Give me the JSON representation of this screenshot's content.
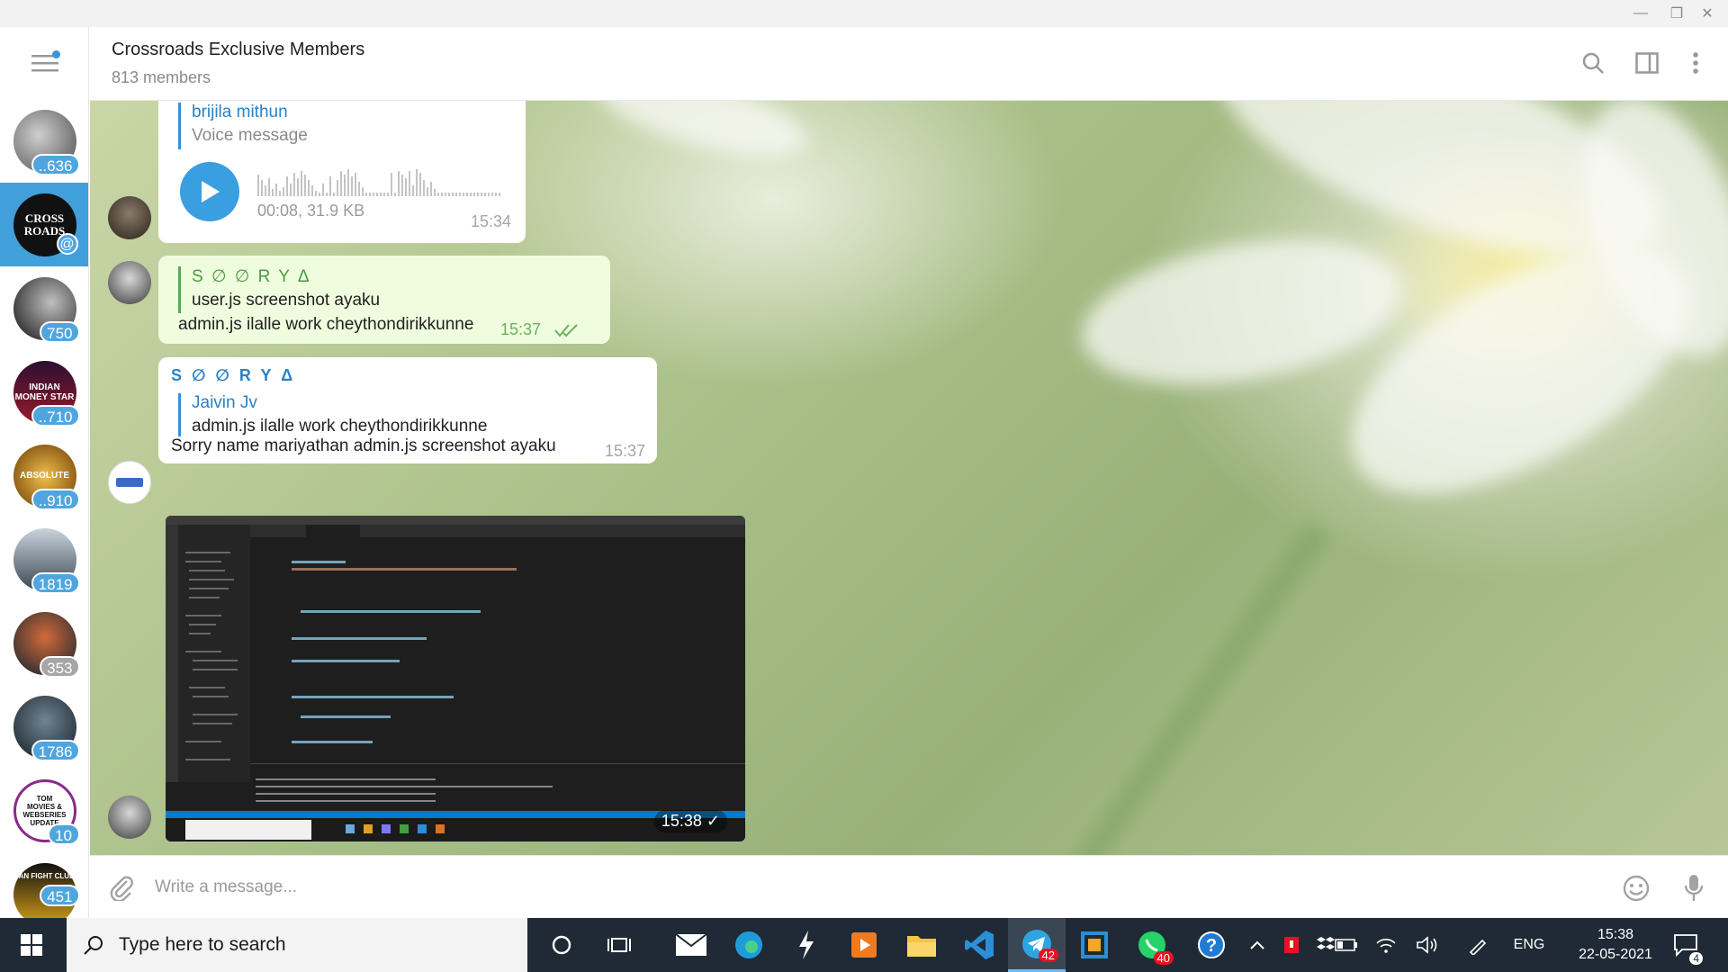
{
  "window": {
    "minimize": "—",
    "maximize": "❐",
    "close": "✕"
  },
  "chat": {
    "title": "Crossroads Exclusive Members",
    "members": "813 members"
  },
  "chat_list": [
    {
      "badge": "..636",
      "muted": false,
      "color": "#6b6b6b"
    },
    {
      "badge": "",
      "mention": "@",
      "active": true,
      "avatar_text": "CROSS ROADS",
      "color": "#111111"
    },
    {
      "badge": "750",
      "muted": false,
      "color": "#222222"
    },
    {
      "badge": "..710",
      "muted": false,
      "avatar_text": "INDIAN MONEY STAR",
      "color": "#7a1a2a"
    },
    {
      "badge": "..910",
      "muted": false,
      "avatar_text": "ABSOLUTE",
      "color": "#b57a10"
    },
    {
      "badge": "1819",
      "muted": false,
      "color": "#4a5565"
    },
    {
      "badge": "353",
      "muted": true,
      "color": "#1f3a4a"
    },
    {
      "badge": "1786",
      "muted": false,
      "color": "#202a30"
    },
    {
      "badge": "10",
      "muted": false,
      "avatar_text": "TOM MOVIES & WEBSERIES UPDATE",
      "color": "#ffffff"
    },
    {
      "badge": "451",
      "muted": false,
      "avatar_text": "FAN FIGHT CLUB",
      "color": "#d7a018"
    }
  ],
  "messages": {
    "voice": {
      "reply_name": "brijila mithun",
      "reply_text": "Voice message",
      "meta": "00:08, 31.9 KB",
      "time": "15:34"
    },
    "outgoing": {
      "reply_name": "S ∅ ∅ R Y Δ",
      "reply_text": "user.js screenshot ayaku",
      "text": "admin.js ilalle work cheythondirikkunne",
      "time": "15:37"
    },
    "incoming": {
      "sender": "S ∅ ∅ R Y Δ",
      "reply_name": "Jaivin Jv",
      "reply_text": "admin.js ilalle work cheythondirikkunne",
      "text": "Sorry name mariyathan admin.js screenshot ayaku",
      "time": "15:37"
    },
    "photo": {
      "time": "15:38"
    }
  },
  "compose": {
    "placeholder": "Write a message..."
  },
  "taskbar": {
    "search_placeholder": "Type here to search",
    "telegram_badge": "42",
    "whatsapp_badge": "40",
    "language": "ENG",
    "time": "15:38",
    "date": "22-05-2021",
    "notifications": "4"
  },
  "colors": {
    "accent": "#419fd9",
    "outgoing_bubble": "#effdde",
    "taskbar": "#1f2a36"
  }
}
